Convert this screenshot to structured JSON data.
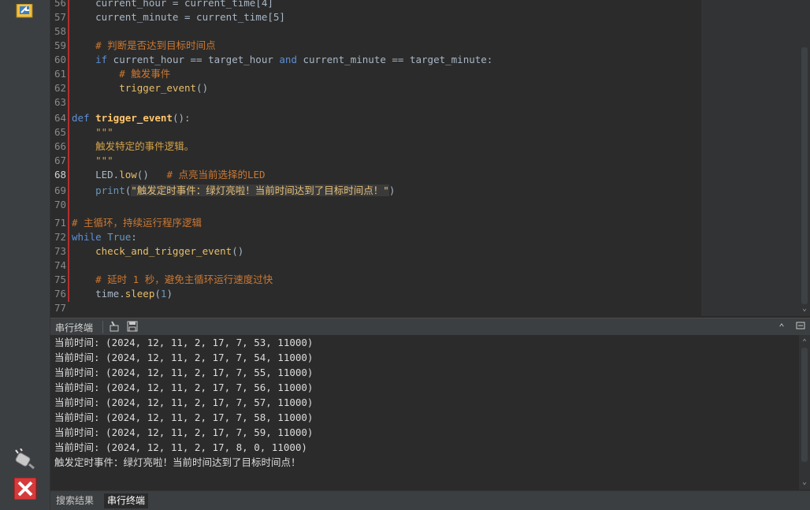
{
  "editor": {
    "lines": [
      {
        "n": "56",
        "html_parts": [
          [
            "",
            "    current_hour = current_time[4]"
          ]
        ]
      },
      {
        "n": "57",
        "html_parts": [
          [
            "",
            "    current_minute = current_time[5]"
          ]
        ]
      },
      {
        "n": "58",
        "html_parts": [
          [
            "",
            ""
          ]
        ]
      },
      {
        "n": "59",
        "html_parts": [
          [
            "cm",
            "    # 判断是否达到目标时间点"
          ]
        ]
      },
      {
        "n": "60",
        "html_parts": [
          [
            "kw2",
            "    if"
          ],
          [
            "",
            " current_hour == target_hour "
          ],
          [
            "kw2",
            "and"
          ],
          [
            "",
            " current_minute == target_minute:"
          ]
        ]
      },
      {
        "n": "61",
        "html_parts": [
          [
            "cm",
            "        # 触发事件"
          ]
        ]
      },
      {
        "n": "62",
        "html_parts": [
          [
            "call",
            "        trigger_event"
          ],
          [
            "",
            "()"
          ]
        ]
      },
      {
        "n": "63",
        "html_parts": [
          [
            "",
            ""
          ]
        ]
      },
      {
        "n": "64",
        "html_parts": [
          [
            "kw2",
            "def"
          ],
          [
            "",
            " "
          ],
          [
            "fn",
            "trigger_event"
          ],
          [
            "",
            "():"
          ]
        ]
      },
      {
        "n": "65",
        "html_parts": [
          [
            "doc",
            "    \"\"\""
          ]
        ]
      },
      {
        "n": "66",
        "html_parts": [
          [
            "doc",
            "    触发特定的事件逻辑。"
          ]
        ]
      },
      {
        "n": "67",
        "html_parts": [
          [
            "doc",
            "    \"\"\""
          ]
        ]
      },
      {
        "n": "68",
        "html_parts": [
          [
            "",
            "    LED."
          ],
          [
            "call",
            "low"
          ],
          [
            "",
            "()   "
          ],
          [
            "cm",
            "# 点亮当前选择的LED"
          ]
        ]
      },
      {
        "n": "69",
        "html_parts": [
          [
            "kw",
            "    print"
          ],
          [
            "",
            "("
          ],
          [
            "str strhl",
            "\"触发定时事件：绿灯亮啦！当前时间达到了目标时间点！\""
          ],
          [
            "",
            ")"
          ]
        ]
      },
      {
        "n": "70",
        "html_parts": [
          [
            "",
            ""
          ]
        ]
      },
      {
        "n": "71",
        "html_parts": [
          [
            "cm",
            "# 主循环，持续运行程序逻辑"
          ]
        ]
      },
      {
        "n": "72",
        "html_parts": [
          [
            "kw2",
            "while"
          ],
          [
            "",
            " "
          ],
          [
            "kw",
            "True"
          ],
          [
            "",
            ":"
          ]
        ]
      },
      {
        "n": "73",
        "html_parts": [
          [
            "call",
            "    check_and_trigger_event"
          ],
          [
            "",
            "()"
          ]
        ]
      },
      {
        "n": "74",
        "html_parts": [
          [
            "",
            ""
          ]
        ]
      },
      {
        "n": "75",
        "html_parts": [
          [
            "cm",
            "    # 延时 1 秒，避免主循环运行速度过快"
          ]
        ]
      },
      {
        "n": "76",
        "html_parts": [
          [
            "",
            "    time."
          ],
          [
            "call",
            "sleep"
          ],
          [
            "",
            "("
          ],
          [
            "num",
            "1"
          ],
          [
            "",
            ")"
          ]
        ]
      },
      {
        "n": "77",
        "html_parts": [
          [
            "",
            ""
          ]
        ]
      }
    ],
    "current_line": "68"
  },
  "panel": {
    "title": "串行终端",
    "output": [
      "当前时间: (2024, 12, 11, 2, 17, 7, 53, 11000)",
      "当前时间: (2024, 12, 11, 2, 17, 7, 54, 11000)",
      "当前时间: (2024, 12, 11, 2, 17, 7, 55, 11000)",
      "当前时间: (2024, 12, 11, 2, 17, 7, 56, 11000)",
      "当前时间: (2024, 12, 11, 2, 17, 7, 57, 11000)",
      "当前时间: (2024, 12, 11, 2, 17, 7, 58, 11000)",
      "当前时间: (2024, 12, 11, 2, 17, 7, 59, 11000)",
      "当前时间: (2024, 12, 11, 2, 17, 8, 0, 11000)",
      "触发定时事件：绿灯亮啦！当前时间达到了目标时间点！"
    ]
  },
  "bottom_tabs": [
    {
      "label": "搜索结果",
      "active": false
    },
    {
      "label": "串行终端",
      "active": true
    }
  ],
  "icons": {
    "top_tool": "python-file-icon",
    "plug": "plug-icon",
    "stop": "stop-icon"
  },
  "colors": {
    "accent_red": "#b52d2d",
    "background": "#2b2b2b",
    "panel": "#3c3f41"
  }
}
